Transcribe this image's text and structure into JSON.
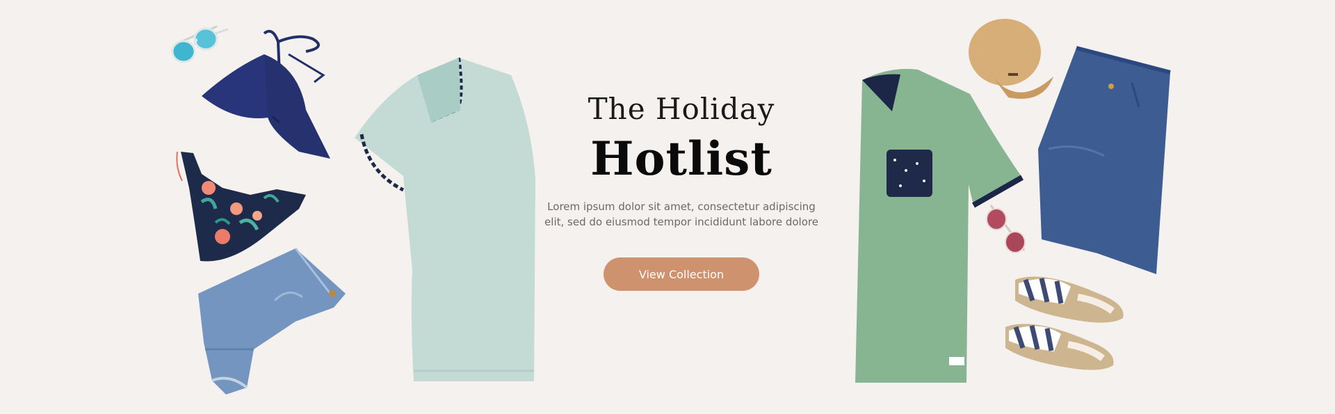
{
  "hero": {
    "title_line1": "The Holiday",
    "title_line2": "Hotlist",
    "description": "Lorem ipsum dolor sit amet, consectetur adipiscing elit, sed do eiusmod tempor incididunt labore dolore",
    "cta_label": "View Collection"
  },
  "colors": {
    "background": "#f4f1ef",
    "accent": "#cf926e",
    "headline": "#0a0a0a",
    "body_text": "#6a6a6a"
  },
  "products": [
    {
      "name": "sunglasses-mirrored-icon"
    },
    {
      "name": "navy-bikini-top-icon"
    },
    {
      "name": "floral-bikini-bottom-icon"
    },
    {
      "name": "denim-shorts-icon"
    },
    {
      "name": "mint-tee-icon"
    },
    {
      "name": "green-pocket-tee-icon"
    },
    {
      "name": "tan-cap-icon"
    },
    {
      "name": "denim-shorts-men-icon"
    },
    {
      "name": "red-sunglasses-icon"
    },
    {
      "name": "striped-espadrilles-icon"
    }
  ]
}
